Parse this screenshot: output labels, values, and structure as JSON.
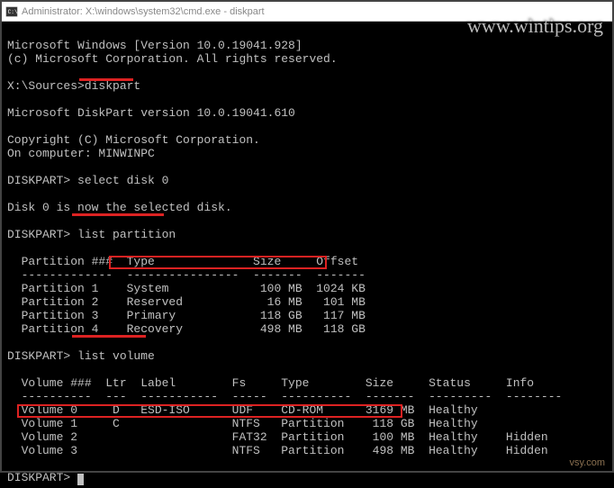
{
  "titlebar": {
    "text": "Administrator: X:\\windows\\system32\\cmd.exe - diskpart"
  },
  "watermark": "www.wintips.org",
  "footer_credit": "vsy.com",
  "lines": {
    "l1": "Microsoft Windows [Version 10.0.19041.928]",
    "l2": "(c) Microsoft Corporation. All rights reserved.",
    "l3": "X:\\Sources>diskpart",
    "l4": "Microsoft DiskPart version 10.0.19041.610",
    "l5": "Copyright (C) Microsoft Corporation.",
    "l6": "On computer: MINWINPC",
    "l7": "DISKPART> select disk 0",
    "l8": "Disk 0 is now the selected disk.",
    "l9": "DISKPART> list partition",
    "ph": "  Partition ###  Type              Size     Offset",
    "pd": "  -------------  ----------------  -------  -------",
    "p1": "  Partition 1    System             100 MB  1024 KB",
    "p2": "  Partition 2    Reserved            16 MB   101 MB",
    "p3": "  Partition 3    Primary            118 GB   117 MB",
    "p4": "  Partition 4    Recovery           498 MB   118 GB",
    "l10": "DISKPART> list volume",
    "vh": "  Volume ###  Ltr  Label        Fs     Type        Size     Status     Info",
    "vd": "  ----------  ---  -----------  -----  ----------  -------  ---------  --------",
    "v0": "  Volume 0     D   ESD-ISO      UDF    CD-ROM      3169 MB  Healthy",
    "v1": "  Volume 1     C                NTFS   Partition    118 GB  Healthy",
    "v2": "  Volume 2                      FAT32  Partition    100 MB  Healthy    Hidden",
    "v3": "  Volume 3                      NTFS   Partition    498 MB  Healthy    Hidden",
    "l11": "DISKPART> "
  },
  "chart_data": {
    "type": "table",
    "tables": [
      {
        "title": "list partition",
        "columns": [
          "Partition ###",
          "Type",
          "Size",
          "Offset"
        ],
        "rows": [
          [
            "Partition 1",
            "System",
            "100 MB",
            "1024 KB"
          ],
          [
            "Partition 2",
            "Reserved",
            "16 MB",
            "101 MB"
          ],
          [
            "Partition 3",
            "Primary",
            "118 GB",
            "117 MB"
          ],
          [
            "Partition 4",
            "Recovery",
            "498 MB",
            "118 GB"
          ]
        ]
      },
      {
        "title": "list volume",
        "columns": [
          "Volume ###",
          "Ltr",
          "Label",
          "Fs",
          "Type",
          "Size",
          "Status",
          "Info"
        ],
        "rows": [
          [
            "Volume 0",
            "D",
            "ESD-ISO",
            "UDF",
            "CD-ROM",
            "3169 MB",
            "Healthy",
            ""
          ],
          [
            "Volume 1",
            "C",
            "",
            "NTFS",
            "Partition",
            "118 GB",
            "Healthy",
            ""
          ],
          [
            "Volume 2",
            "",
            "",
            "FAT32",
            "Partition",
            "100 MB",
            "Healthy",
            "Hidden"
          ],
          [
            "Volume 3",
            "",
            "",
            "NTFS",
            "Partition",
            "498 MB",
            "Healthy",
            "Hidden"
          ]
        ]
      }
    ]
  }
}
